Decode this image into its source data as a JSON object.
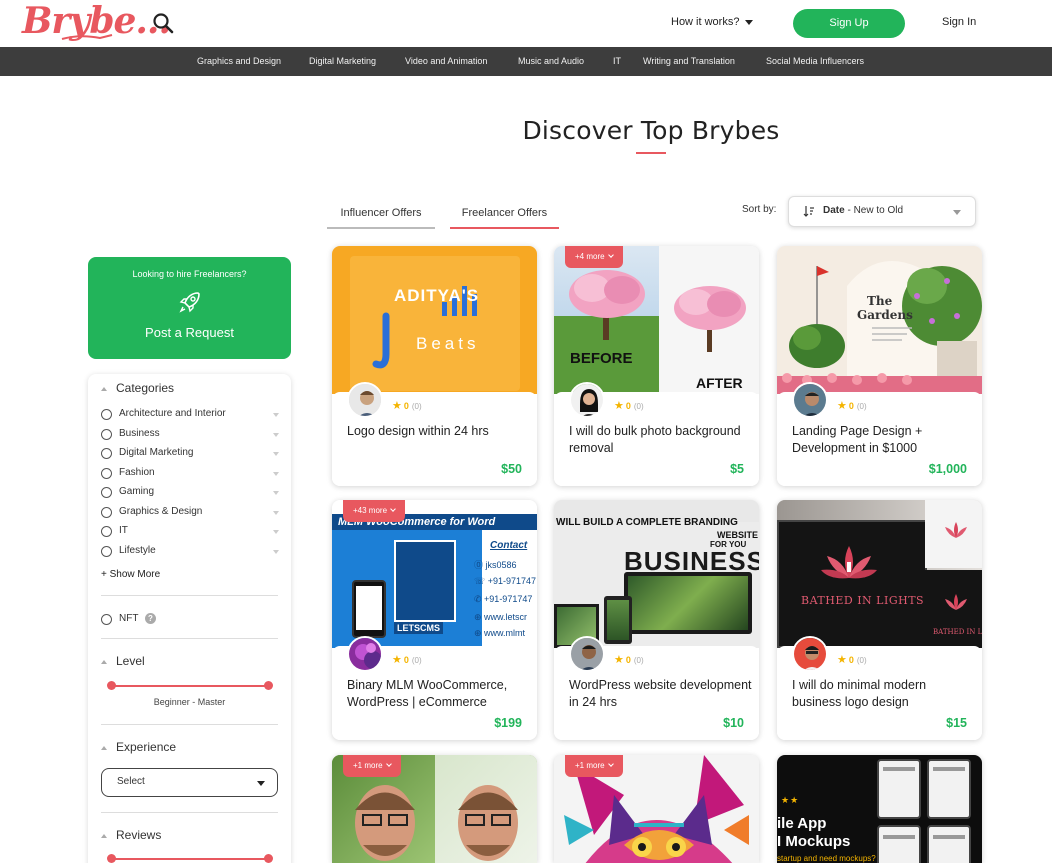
{
  "header": {
    "logo": "Brybe...",
    "how_it_works": "How it works?",
    "sign_up": "Sign Up",
    "sign_in": "Sign In"
  },
  "categories_bar": [
    "Graphics and Design",
    "Digital Marketing",
    "Video and Animation",
    "Music and Audio",
    "IT",
    "Writing and Translation",
    "Social Media Influencers"
  ],
  "page_title": "Discover Top Brybes",
  "tabs": {
    "influencer": "Influencer Offers",
    "freelancer": "Freelancer Offers"
  },
  "sort": {
    "label": "Sort by:",
    "value_bold": "Date",
    "value_rest": " - New to Old"
  },
  "hire": {
    "small": "Looking to hire Freelancers?",
    "big": "Post a Request"
  },
  "filters": {
    "categories_title": "Categories",
    "categories": [
      "Architecture and Interior",
      "Business",
      "Digital Marketing",
      "Fashion",
      "Gaming",
      "Graphics & Design",
      "IT",
      "Lifestyle"
    ],
    "show_more": "+ Show More",
    "nft": "NFT",
    "nft_help": "?",
    "level_title": "Level",
    "level_range": "Beginner - Master",
    "experience_title": "Experience",
    "experience_select": "Select",
    "reviews_title": "Reviews"
  },
  "cards": [
    {
      "title": "Logo design within 24 hrs",
      "price": "$50",
      "score": "0",
      "count": "(0)",
      "more": "",
      "thumb_text": [
        "ADITYA'S",
        "Beats"
      ]
    },
    {
      "title": "I will do bulk photo background removal",
      "price": "$5",
      "score": "0",
      "count": "(0)",
      "more": "+4 more",
      "thumb_text": [
        "BEFORE",
        "AFTER"
      ]
    },
    {
      "title": "Landing Page Design + Development in $1000",
      "price": "$1,000",
      "score": "0",
      "count": "(0)",
      "more": "",
      "thumb_text": [
        "The",
        "Gardens"
      ]
    },
    {
      "title": "Binary MLM WooCommerce, WordPress | eCommerce",
      "price": "$199",
      "score": "0",
      "count": "(0)",
      "more": "+43 more",
      "thumb_text": [
        "MLM WooCommerce for Word",
        "Contact",
        "jks0586",
        "+91-971747",
        "+91-971747",
        "www.letscr",
        "www.mlmt",
        "LETSCMS"
      ]
    },
    {
      "title": "WordPress website development in 24 hrs",
      "price": "$10",
      "score": "0",
      "count": "(0)",
      "more": "",
      "thumb_text": [
        "WILL BUILD A COMPLETE BRANDING",
        "WEBSITE",
        "FOR YOU",
        "BUSINESS"
      ]
    },
    {
      "title": "I will do minimal modern business logo design",
      "price": "$15",
      "score": "0",
      "count": "(0)",
      "more": "",
      "thumb_text": [
        "BATHED IN LIGHTS",
        "BATHED IN LIGH"
      ]
    },
    {
      "title": "",
      "price": "",
      "score": "",
      "count": "",
      "more": "+1 more",
      "thumb_text": []
    },
    {
      "title": "",
      "price": "",
      "score": "",
      "count": "",
      "more": "+1 more",
      "thumb_text": []
    },
    {
      "title": "",
      "price": "",
      "score": "",
      "count": "",
      "more": "",
      "thumb_text": [
        "ile App",
        "I Mockups",
        "startup and need mockups?"
      ]
    }
  ],
  "colors": {
    "brand": "#e8585f",
    "green": "#22b45a",
    "catbar": "#3d3d3d",
    "star": "#f4b400"
  }
}
